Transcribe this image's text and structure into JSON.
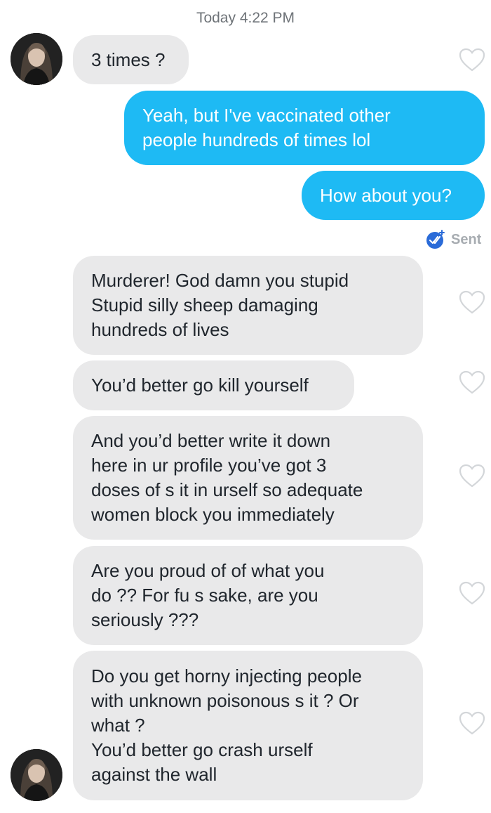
{
  "timestamp": "Today 4:22 PM",
  "messages": [
    {
      "text": "3 times ?"
    },
    {
      "text": "Yeah, but I've vaccinated other\npeople hundreds of times lol"
    },
    {
      "text": "How about you?"
    },
    {
      "text": "Murderer! God damn you stupid\nStupid silly sheep damaging\nhundreds of lives"
    },
    {
      "text": "You’d better go kill yourself"
    },
    {
      "text": "And you’d better write it down\nhere in ur profile you’ve got 3\ndoses of s  it in urself so adequate\nwomen block you immediately"
    },
    {
      "text": "Are you proud of of what you\ndo ?? For fu    s sake, are you\nseriously ???"
    },
    {
      "text": "Do you get horny injecting people\nwith unknown poisonous s  it ? Or\nwhat ?\nYou’d better go crash urself\nagainst the wall"
    }
  ],
  "status": {
    "label": "Sent",
    "icon": "double-check-icon"
  },
  "colors": {
    "outgoing_bubble": "#1ebaf4",
    "incoming_bubble": "#e9e9ea",
    "status_badge": "#2a6bd8",
    "heart_outline": "#d3d6d9"
  }
}
